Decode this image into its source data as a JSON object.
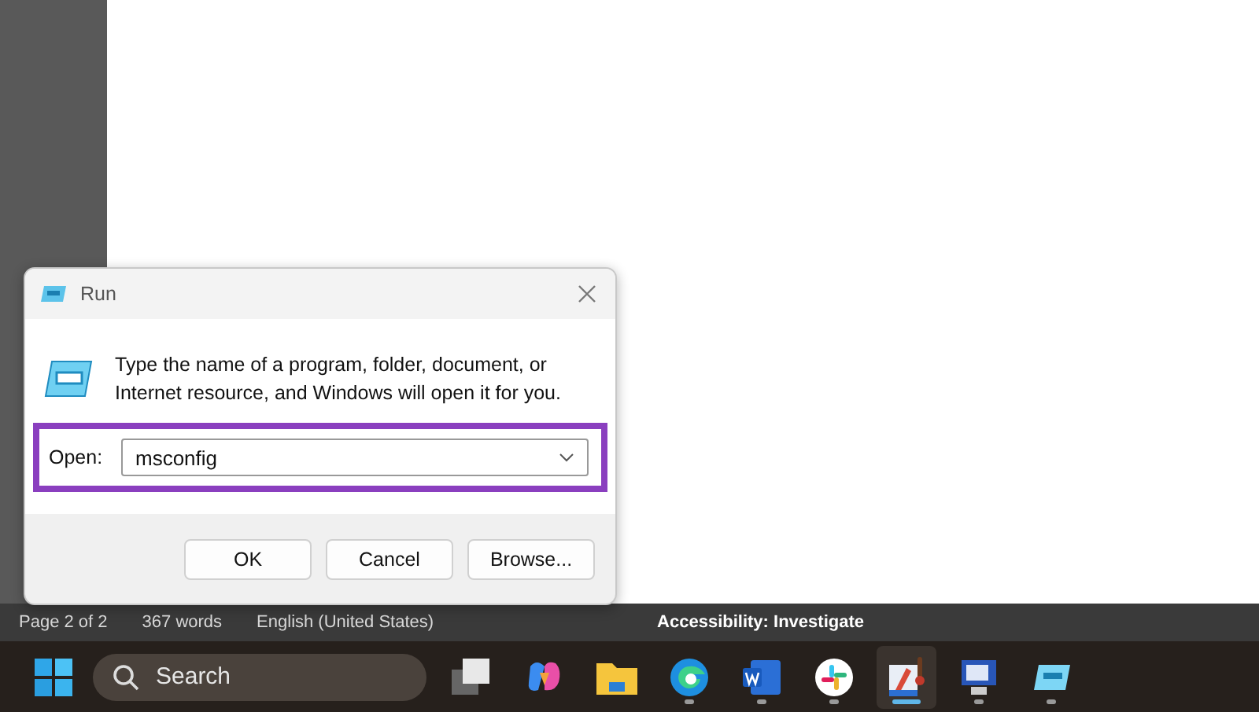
{
  "dialog": {
    "title": "Run",
    "message": "Type the name of a program, folder, document, or Internet resource, and Windows will open it for you.",
    "open_label": "Open:",
    "open_value": "msconfig",
    "highlighted": true,
    "buttons": [
      "OK",
      "Cancel",
      "Browse..."
    ]
  },
  "status_bar": {
    "items": [
      "Page 2 of 2",
      "367 words",
      "English (United States)",
      "Accessibility: Investigate"
    ]
  },
  "taskbar": {
    "search": {
      "placeholder": "Search"
    },
    "apps": [
      {
        "kind": "taskview",
        "running": false,
        "selected": false
      },
      {
        "kind": "copilot",
        "running": false,
        "selected": false
      },
      {
        "kind": "files",
        "running": false,
        "selected": false
      },
      {
        "kind": "edge",
        "running": true,
        "selected": false
      },
      {
        "kind": "word",
        "running": true,
        "selected": false
      },
      {
        "kind": "slack",
        "running": true,
        "selected": false
      },
      {
        "kind": "thermo",
        "running": true,
        "selected": true
      },
      {
        "kind": "remote",
        "running": true,
        "selected": false
      },
      {
        "kind": "run",
        "running": true,
        "selected": false
      }
    ]
  }
}
